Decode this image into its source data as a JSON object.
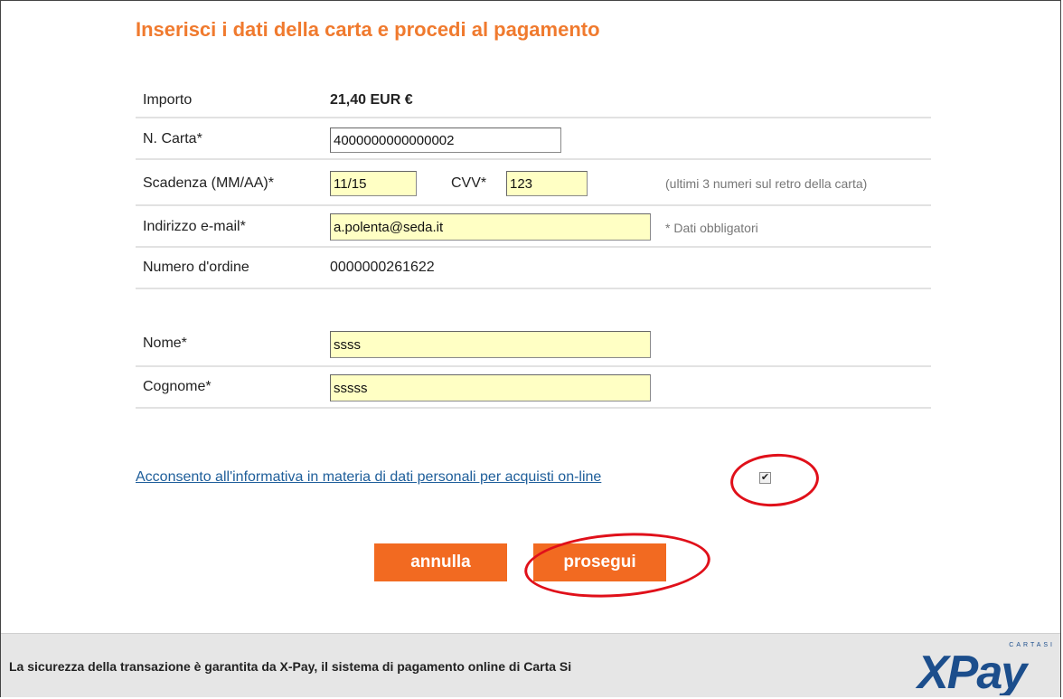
{
  "page_title": "Inserisci i dati della carta e procedi al pagamento",
  "form": {
    "amount": {
      "label": "Importo",
      "value": "21,40 EUR €"
    },
    "card_number": {
      "label": "N. Carta*",
      "value": "4000000000000002"
    },
    "expiry": {
      "label": "Scadenza (MM/AA)*",
      "value": "11/15"
    },
    "cvv": {
      "label": "CVV*",
      "value": "123",
      "hint": "(ultimi 3 numeri sul retro della carta)"
    },
    "email": {
      "label": "Indirizzo e-mail*",
      "value": "a.polenta@seda.it",
      "hint": "* Dati obbligatori"
    },
    "order_number": {
      "label": "Numero d'ordine",
      "value": "0000000261622"
    },
    "first_name": {
      "label": "Nome*",
      "value": "ssss"
    },
    "last_name": {
      "label": "Cognome*",
      "value": "sssss"
    }
  },
  "consent": {
    "link_text": "Acconsento all'informativa in materia di dati personali per acquisti on-line",
    "checked": true
  },
  "buttons": {
    "cancel_label": "annulla",
    "continue_label": "prosegui"
  },
  "footer": {
    "text": "La sicurezza della transazione è garantita da X-Pay, il sistema di pagamento online di Carta Si",
    "logo_text": "XPay",
    "logo_caption": "CARTASI"
  },
  "colors": {
    "accent": "#f07a2e",
    "button": "#f26a21",
    "annotation": "#e0101a",
    "input_fill": "#ffffc4",
    "link": "#1e5e9a",
    "logo": "#1c4e8c"
  }
}
